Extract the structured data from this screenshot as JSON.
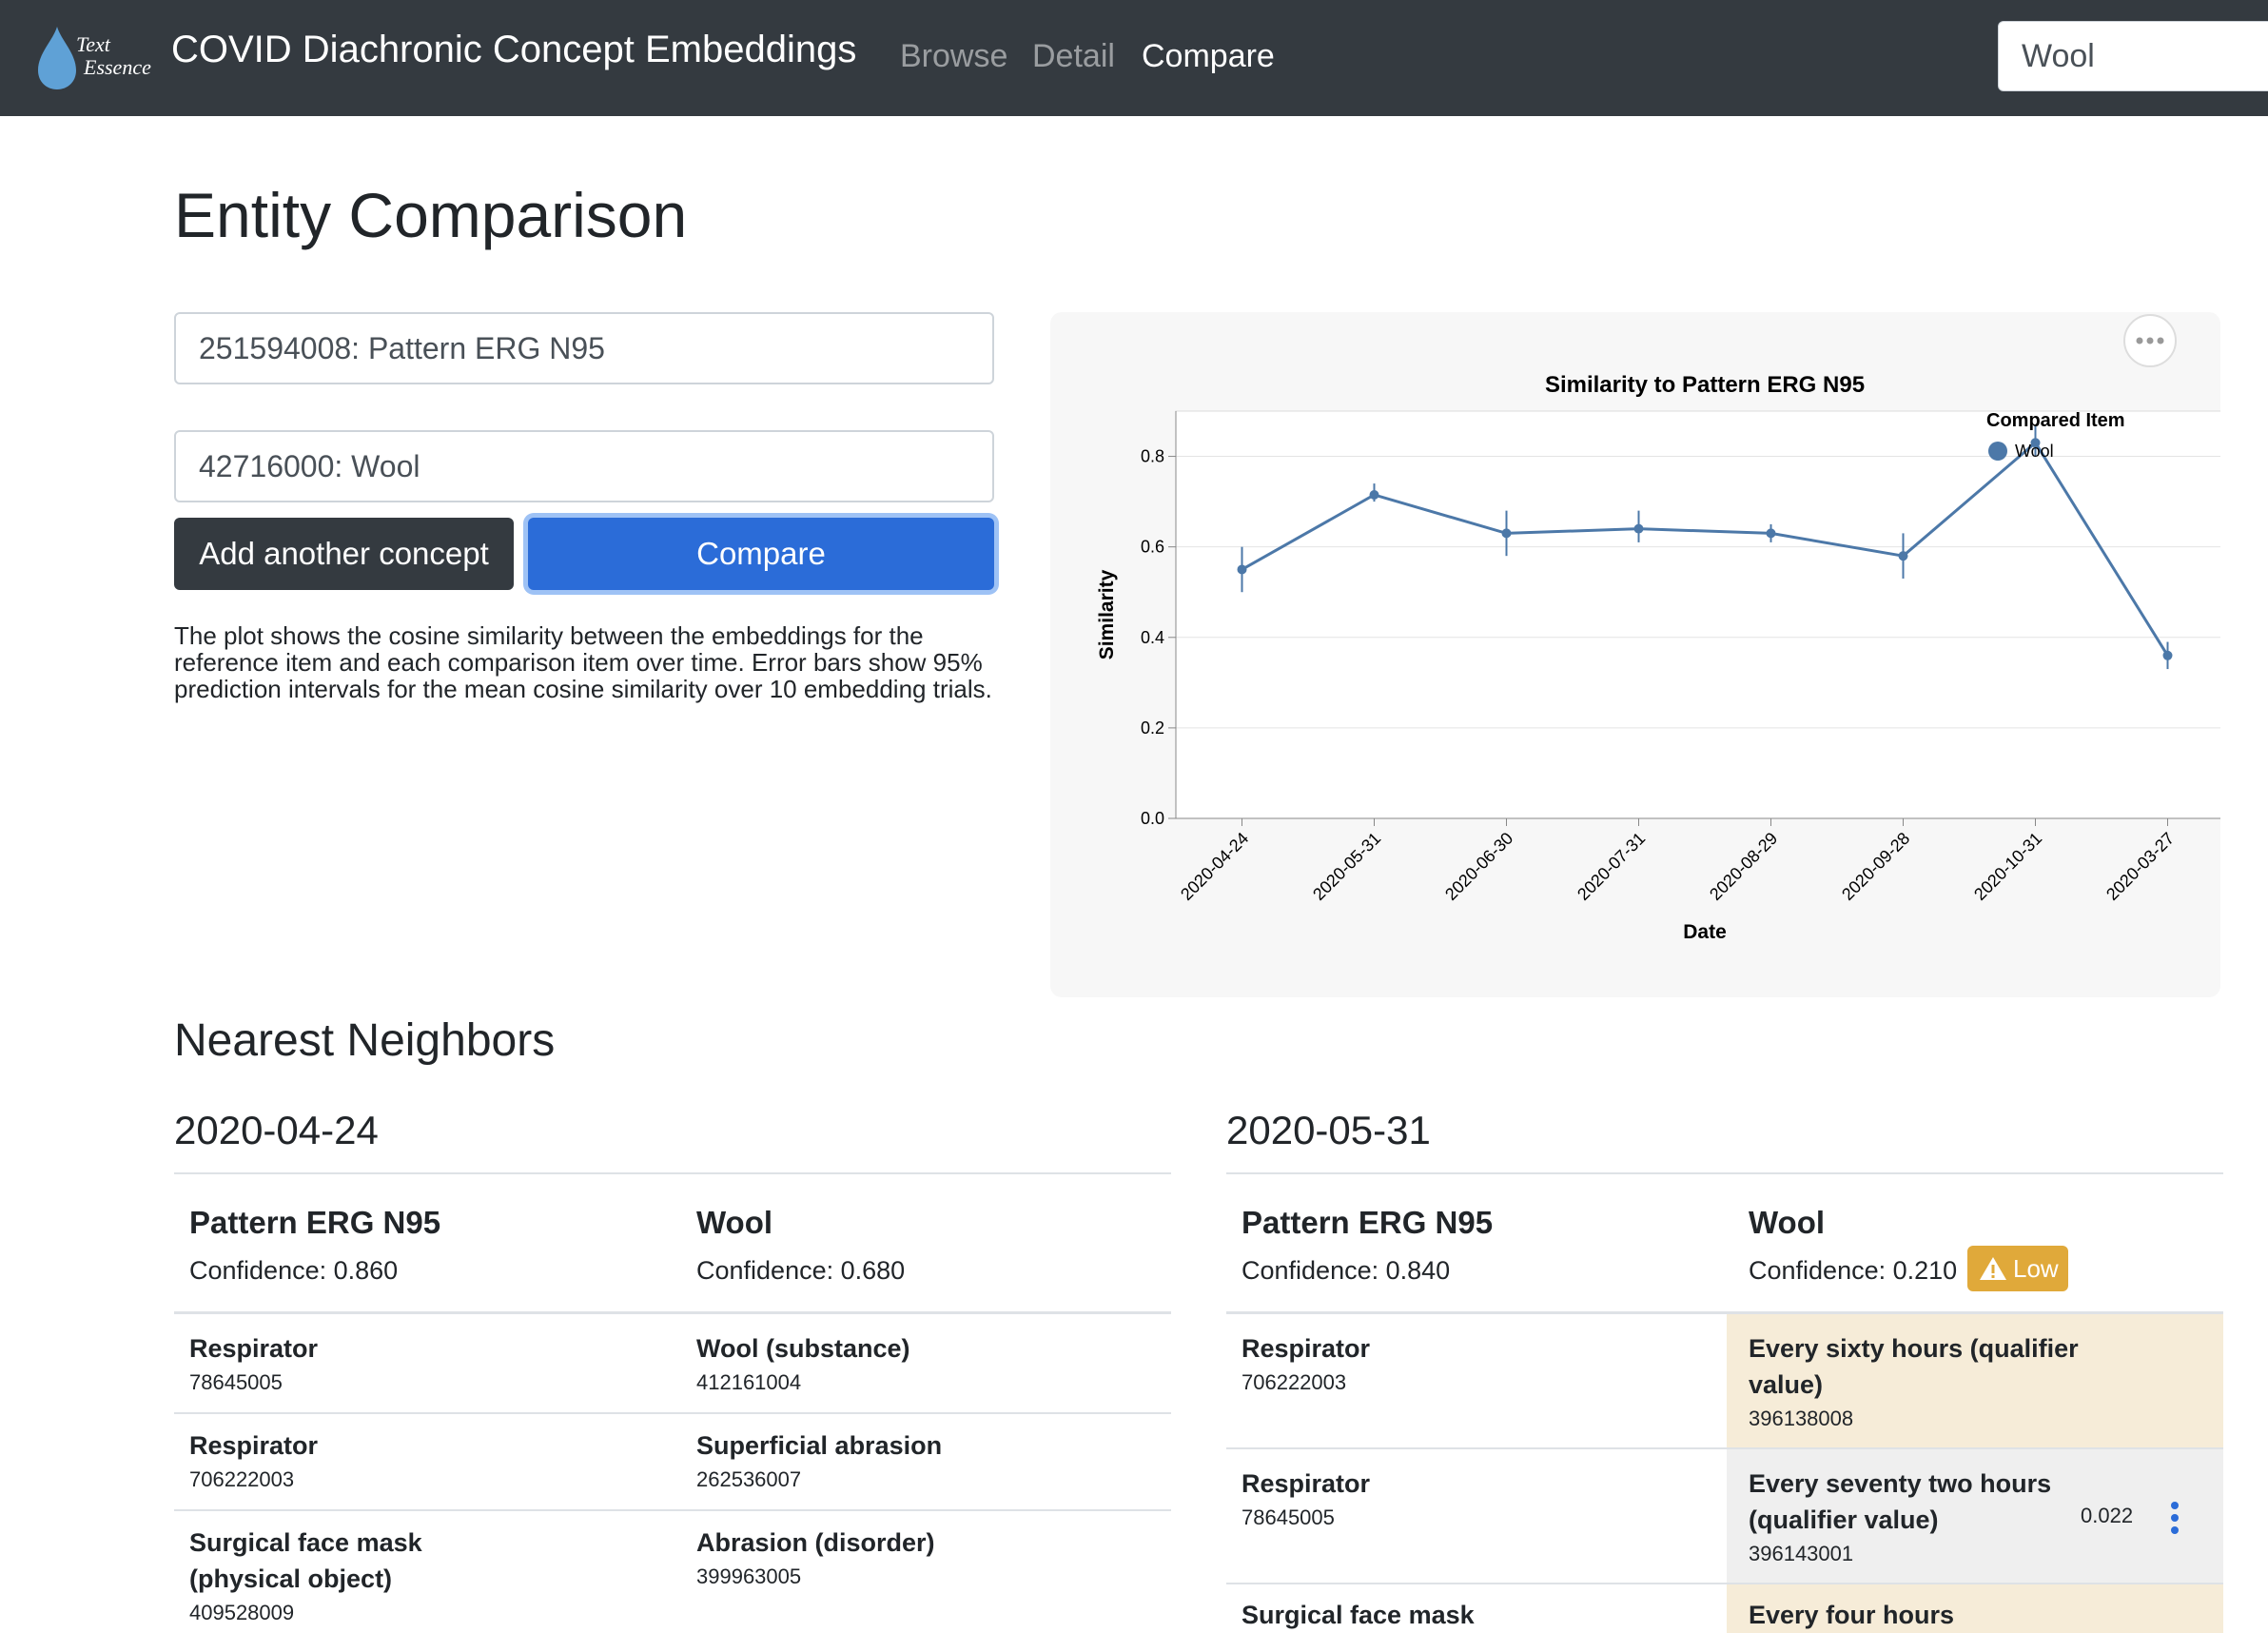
{
  "navbar": {
    "logo_text_top": "Text",
    "logo_text_bottom": "Essence",
    "brand": "COVID Diachronic Concept Embeddings",
    "links": [
      {
        "label": "Browse",
        "active": false
      },
      {
        "label": "Detail",
        "active": false
      },
      {
        "label": "Compare",
        "active": true
      }
    ],
    "search_value": "Wool"
  },
  "page": {
    "title": "Entity Comparison",
    "concept_inputs": [
      "251594008: Pattern ERG N95",
      "42716000: Wool"
    ],
    "add_button": "Add another concept",
    "compare_button": "Compare",
    "explanation": "The plot shows the cosine similarity between the embeddings for the reference item and each comparison item over time. Error bars show 95% prediction intervals for the mean cosine similarity over 10 embedding trials."
  },
  "chart_data": {
    "type": "line",
    "title": "Similarity to Pattern ERG N95",
    "xlabel": "Date",
    "ylabel": "Similarity",
    "categories": [
      "2020-04-24",
      "2020-05-31",
      "2020-06-30",
      "2020-07-31",
      "2020-08-29",
      "2020-09-28",
      "2020-10-31",
      "2020-03-27"
    ],
    "series": [
      {
        "name": "Wool",
        "color": "#4c78a8",
        "values": [
          0.55,
          0.715,
          0.63,
          0.64,
          0.63,
          0.58,
          0.83,
          0.36
        ],
        "ci_low": [
          0.5,
          0.7,
          0.58,
          0.61,
          0.61,
          0.53,
          0.8,
          0.33
        ],
        "ci_high": [
          0.6,
          0.74,
          0.68,
          0.68,
          0.65,
          0.63,
          0.87,
          0.39
        ]
      }
    ],
    "ylim": [
      0,
      0.9
    ],
    "yticks": [
      "0.0",
      "0.2",
      "0.4",
      "0.6",
      "0.8"
    ],
    "ytick_values": [
      0,
      0.2,
      0.4,
      0.6,
      0.8
    ],
    "legend_title": "Compared Item",
    "legend_position": "top-right",
    "grid": true
  },
  "neighbors": {
    "title": "Nearest Neighbors",
    "panels": [
      {
        "date": "2020-04-24",
        "ref": {
          "name": "Pattern ERG N95",
          "confidence": "Confidence: 0.860"
        },
        "cmp": {
          "name": "Wool",
          "confidence": "Confidence: 0.680",
          "badge": ""
        },
        "rows": [
          {
            "ref_name": "Respirator",
            "ref_code": "78645005",
            "cmp_name": "Wool (substance)",
            "cmp_code": "412161004"
          },
          {
            "ref_name": "Respirator",
            "ref_code": "706222003",
            "cmp_name": "Superficial abrasion",
            "cmp_code": "262536007"
          },
          {
            "ref_name_1": "Surgical face mask",
            "ref_name_2": "(physical object)",
            "ref_code": "409528009",
            "cmp_name": "Abrasion (disorder)",
            "cmp_code": "399963005"
          }
        ]
      },
      {
        "date": "2020-05-31",
        "ref": {
          "name": "Pattern ERG N95",
          "confidence": "Confidence: 0.840"
        },
        "cmp": {
          "name": "Wool",
          "confidence": "Confidence: 0.210",
          "badge": "Low"
        },
        "rows": [
          {
            "ref_name": "Respirator",
            "ref_code": "706222003",
            "cmp_name_1": "Every sixty hours (qualifier",
            "cmp_name_2": "value)",
            "cmp_code": "396138008"
          },
          {
            "ref_name": "Respirator",
            "ref_code": "78645005",
            "cmp_name_1": "Every seventy two hours",
            "cmp_name_2": "(qualifier value)",
            "cmp_code": "396143001",
            "score": "0.022"
          },
          {
            "ref_name": "Surgical face mask",
            "cmp_name": "Every four hours"
          }
        ]
      }
    ]
  },
  "colors": {
    "navbar": "#343a40",
    "primary": "#2b6cd8",
    "warning": "#e0a93a",
    "highlight": "#f6ecd8",
    "series": "#4c78a8"
  }
}
